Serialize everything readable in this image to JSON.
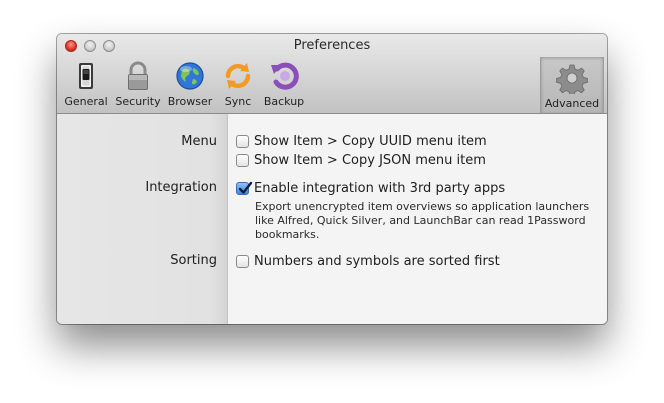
{
  "window": {
    "title": "Preferences"
  },
  "toolbar": {
    "items": [
      {
        "label": "General",
        "icon": "switch-icon"
      },
      {
        "label": "Security",
        "icon": "padlock-icon"
      },
      {
        "label": "Browser",
        "icon": "globe-icon"
      },
      {
        "label": "Sync",
        "icon": "sync-arrows-icon"
      },
      {
        "label": "Backup",
        "icon": "backup-arrow-icon"
      },
      {
        "label": "Advanced",
        "icon": "gear-icon",
        "selected": true
      }
    ]
  },
  "sections": {
    "menu": {
      "label": "Menu",
      "options": [
        {
          "label": "Show Item > Copy UUID menu item",
          "checked": false
        },
        {
          "label": "Show Item > Copy JSON menu item",
          "checked": false
        }
      ]
    },
    "integration": {
      "label": "Integration",
      "options": [
        {
          "label": "Enable integration with 3rd party apps",
          "checked": true
        }
      ],
      "description": "Export unencrypted item overviews so application launchers like Alfred, Quick Silver, and LaunchBar can read 1Password bookmarks."
    },
    "sorting": {
      "label": "Sorting",
      "options": [
        {
          "label": "Numbers and symbols are sorted first",
          "checked": false
        }
      ]
    }
  },
  "colors": {
    "checkbox_checked": "#3a85de",
    "close_button": "#e5382b",
    "sync_icon": "#f39a24",
    "backup_icon": "#8a4fb8",
    "browser_icon": "#2f78d8"
  }
}
